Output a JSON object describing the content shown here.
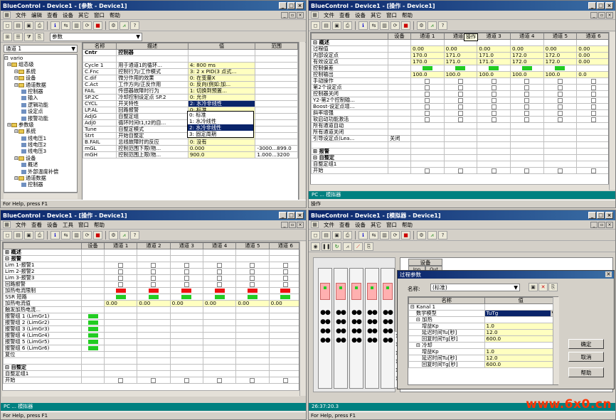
{
  "w1": {
    "title": "BlueControl - Device1 - [参数 - Device1]",
    "menu": [
      "文件",
      "编辑",
      "查看",
      "设备",
      "其它",
      "窗口",
      "帮助"
    ],
    "group_select": "参数",
    "channel_select": "通道 1",
    "root": "vario",
    "tree": [
      {
        "t": "组态级",
        "l": 0,
        "k": "f"
      },
      {
        "t": "系统",
        "l": 1,
        "k": "f"
      },
      {
        "t": "设备",
        "l": 1,
        "k": "f"
      },
      {
        "t": "通道数据",
        "l": 1,
        "k": "f"
      },
      {
        "t": "控制器",
        "l": 2,
        "k": "d"
      },
      {
        "t": "输入",
        "l": 2,
        "k": "d"
      },
      {
        "t": "逻辑功能",
        "l": 2,
        "k": "d"
      },
      {
        "t": "设定点",
        "l": 2,
        "k": "d"
      },
      {
        "t": "报警功能",
        "l": 2,
        "k": "d"
      },
      {
        "t": "参数级",
        "l": 0,
        "k": "f"
      },
      {
        "t": "系统",
        "l": 1,
        "k": "f"
      },
      {
        "t": "线电压1",
        "l": 2,
        "k": "d"
      },
      {
        "t": "线电压2",
        "l": 2,
        "k": "d"
      },
      {
        "t": "线电压3",
        "l": 2,
        "k": "d"
      },
      {
        "t": "设备",
        "l": 1,
        "k": "f"
      },
      {
        "t": "概述",
        "l": 2,
        "k": "d"
      },
      {
        "t": "外部温度补偿",
        "l": 2,
        "k": "d"
      },
      {
        "t": "通道数据",
        "l": 1,
        "k": "f"
      },
      {
        "t": "控制器",
        "l": 2,
        "k": "d"
      }
    ],
    "cols": [
      "名称",
      "描述",
      "值",
      "范围"
    ],
    "rows": [
      [
        "Cntr",
        "控制器",
        "",
        ""
      ],
      [
        "",
        "",
        "",
        ""
      ],
      [
        "Cycle 1",
        "用于通道1的循环...",
        "4: 800 ms",
        ""
      ],
      [
        "C.Fnc",
        "控制行为/工作模式",
        "3: 2 x PID(3 点式...",
        ""
      ],
      [
        "C.dif",
        "微分作用的效果",
        "0: 在变量X",
        ""
      ],
      [
        "C.Act",
        "工作方向/正反作用",
        "0: 反向(例如:加...",
        ""
      ],
      [
        "FAIL",
        "传感器故障时行为",
        "1: 切换到预置...",
        ""
      ],
      [
        "SP.2C",
        "冷却控制设定点 SP.2",
        "0: 允许",
        ""
      ],
      [
        "CYCL",
        "开关特性",
        "2: 水冷非线性",
        ""
      ],
      [
        "LP.AL",
        "回路报警",
        "0: 标准",
        ""
      ],
      [
        "AdjG",
        "自整定组",
        "1: 水冷线性",
        ""
      ],
      [
        "Adj0",
        "循环时间t1,t2的自...",
        "2: 水冷非线性",
        ""
      ],
      [
        "Tune",
        "自整定模式",
        "3: 固定周期",
        ""
      ],
      [
        "Strt",
        "开始自整定",
        "0: 只能手动",
        ""
      ],
      [
        "B.FAIL",
        "总线故障时的反应",
        "0: 没有",
        ""
      ],
      [
        "mGL",
        "控制范围下限(物...",
        "0.000",
        "-3000...899.0"
      ],
      [
        "mGH",
        "控制范围上限(物...",
        "900.0",
        "1.000...3200"
      ]
    ],
    "dropdown": [
      "0: 标准",
      "1: 水冷线性",
      "2: 水冷非线性",
      "3: 固定周期"
    ],
    "status": "For Help, press F1"
  },
  "w2": {
    "title": "BlueControl - Device1 - [操作 - Device1]",
    "menu": [
      "文件",
      "查看",
      "设备",
      "其它",
      "窗口",
      "帮助"
    ],
    "cols": [
      "",
      "设备",
      "通道 1",
      "通道 2",
      "通道 3",
      "通道 4",
      "通道 5",
      "通道 6"
    ],
    "tooltip": "操作",
    "rows": [
      [
        "⊟ 概述",
        "",
        "",
        "",
        "",
        "",
        "",
        ""
      ],
      [
        "过程值",
        "",
        "0.00",
        "0.00",
        "0.00",
        "0.00",
        "0.00",
        "0.00"
      ],
      [
        "内部设定点",
        "",
        "170.0",
        "171.0",
        "171.0",
        "172.0",
        "172.0",
        "0.00"
      ],
      [
        "有效设定点",
        "",
        "170.0",
        "171.0",
        "171.0",
        "172.0",
        "172.0",
        "0.00"
      ],
      [
        "控制偏差",
        "",
        "G",
        "G",
        "G",
        "G",
        "G",
        ""
      ],
      [
        "控制输出",
        "",
        "100.0",
        "100.0",
        "100.0",
        "100.0",
        "100.0",
        "0.0"
      ],
      [
        "手动操作",
        "",
        "C",
        "C",
        "C",
        "C",
        "C",
        "C"
      ],
      [
        "第2个设定点",
        "",
        "C",
        "C",
        "C",
        "C",
        "C",
        "C"
      ],
      [
        "控制器关闭",
        "",
        "C",
        "C",
        "C",
        "C",
        "C",
        "C"
      ],
      [
        "Y2-第2个控制输...",
        "",
        "C",
        "C",
        "C",
        "C",
        "C",
        "C"
      ],
      [
        "Boost-设定点增...",
        "",
        "C",
        "C",
        "C",
        "C",
        "C",
        "C"
      ],
      [
        "斜率增强",
        "",
        "C",
        "C",
        "C",
        "C",
        "C",
        "C"
      ],
      [
        "软启动功能激活",
        "",
        "C",
        "C",
        "C",
        "C",
        "C",
        "C"
      ],
      [
        "所有通道自动",
        "",
        "",
        "",
        "",
        "",
        "",
        ""
      ],
      [
        "所有通道关闭",
        "",
        "",
        "",
        "",
        "",
        "",
        ""
      ],
      [
        "引导设定点(Lea...",
        "关闭",
        "",
        "",
        "",
        "",
        "",
        ""
      ],
      [
        "",
        "",
        "",
        "",
        "",
        "",
        "",
        ""
      ],
      [
        "⊞ 报警",
        "",
        "",
        "",
        "",
        "",
        "",
        ""
      ],
      [
        "⊟ 自整定",
        "",
        "",
        "",
        "",
        "",
        "",
        ""
      ],
      [
        "自整定组1",
        "",
        "",
        "",
        "",
        "",
        "",
        ""
      ],
      [
        "开始",
        "",
        "C",
        "C",
        "C",
        "C",
        "C",
        "C"
      ]
    ],
    "teal": "PC ... 模拟器",
    "status": "操作"
  },
  "w3": {
    "title": "BlueControl - Device1 - [操作 - Device1]",
    "menu": [
      "文件",
      "查看",
      "设备",
      "工具",
      "窗口",
      "帮助"
    ],
    "cols": [
      "",
      "设备",
      "通道 1",
      "通道 2",
      "通道 3",
      "通道 4",
      "通道 5",
      "通道 6"
    ],
    "rows": [
      [
        "⊞ 概述",
        "",
        "",
        "",
        "",
        "",
        "",
        ""
      ],
      [
        "⊟ 报警",
        "",
        "",
        "",
        "",
        "",
        "",
        ""
      ],
      [
        "Lim 1-报警1",
        "",
        "C",
        "C",
        "C",
        "C",
        "C",
        "C"
      ],
      [
        "Lim 2-报警2",
        "",
        "C",
        "C",
        "C",
        "C",
        "C",
        "C"
      ],
      [
        "Lim 3-报警3",
        "",
        "C",
        "C",
        "C",
        "C",
        "C",
        "C"
      ],
      [
        "回路报警",
        "",
        "C",
        "C",
        "C",
        "C",
        "C",
        "C"
      ],
      [
        "加热电流限制",
        "",
        "R",
        "R",
        "R",
        "R",
        "R",
        "R"
      ],
      [
        "SSR 短路",
        "",
        "G",
        "G",
        "G",
        "G",
        "G",
        "G"
      ],
      [
        "加热电流值",
        "",
        "0.00",
        "0.00",
        "0.00",
        "0.00",
        "0.00",
        "0.00"
      ],
      [
        "触发加热电流...",
        "",
        "",
        "",
        "",
        "",
        "",
        ""
      ],
      [
        "报警组 1 (LimGr1)",
        "G",
        "",
        "",
        "",
        "",
        "",
        ""
      ],
      [
        "报警组 2 (LimGr2)",
        "G",
        "",
        "",
        "",
        "",
        "",
        ""
      ],
      [
        "报警组 3 (LimGr3)",
        "G",
        "",
        "",
        "",
        "",
        "",
        ""
      ],
      [
        "报警组 4 (LimGr4)",
        "G",
        "",
        "",
        "",
        "",
        "",
        ""
      ],
      [
        "报警组 5 (LimGr5)",
        "G",
        "",
        "",
        "",
        "",
        "",
        ""
      ],
      [
        "报警组 6 (LimGr6)",
        "G",
        "",
        "",
        "",
        "",
        "",
        ""
      ],
      [
        "复位",
        "",
        "",
        "",
        "",
        "",
        "",
        ""
      ],
      [
        "",
        "",
        "",
        "",
        "",
        "",
        "",
        ""
      ],
      [
        "⊟ 自整定",
        "",
        "",
        "",
        "",
        "",
        "",
        ""
      ],
      [
        "自整定组1",
        "",
        "",
        "",
        "",
        "",
        "",
        ""
      ],
      [
        "开始",
        "",
        "C",
        "C",
        "C",
        "C",
        "C",
        "C"
      ]
    ],
    "teal": "PC ... 模拟器",
    "status": "For Help, press F1"
  },
  "w4": {
    "title": "BlueControl - Device1 - [模拟器 - Device1]",
    "menu": [
      "文件",
      "查看",
      "设备",
      "其它",
      "窗口",
      "帮助"
    ],
    "dev_col": "设备",
    "inp": "Inp",
    "out": "Out",
    "teal": "26:37:20.3",
    "status": "For Help, press F1",
    "dialog": {
      "title": "过程参数",
      "name_label": "名称:",
      "name_value": "(标准)",
      "cols": [
        "名称",
        "值"
      ],
      "rows": [
        [
          "⊟ Kanal 1",
          "",
          0
        ],
        [
          "数学模型",
          "TuTg",
          1
        ],
        [
          "⊟ 加热",
          "",
          1
        ],
        [
          "增益Kp",
          "1.0",
          2
        ],
        [
          "延迟时间Tu[秒]",
          "12.0",
          2
        ],
        [
          "回复时间Tg[秒]",
          "600.0",
          2
        ],
        [
          "⊟ 冷却",
          "",
          1
        ],
        [
          "增益Kp",
          "1.0",
          2
        ],
        [
          "延迟时间Tu[秒]",
          "12.0",
          2
        ],
        [
          "回复时间Tg[秒]",
          "600.0",
          2
        ]
      ],
      "ok": "确定",
      "cancel": "取消",
      "help": "帮助"
    }
  },
  "watermark": "www.6x0.cn"
}
